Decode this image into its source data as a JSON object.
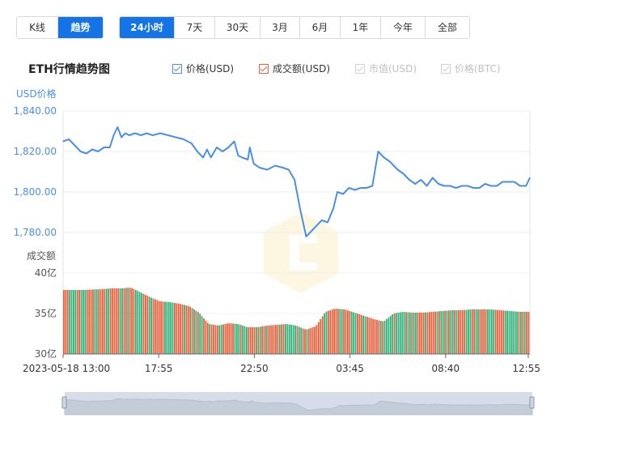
{
  "view_toggle": [
    {
      "label": "K线",
      "active": false
    },
    {
      "label": "趋势",
      "active": true
    }
  ],
  "ranges": [
    {
      "label": "24小时",
      "active": true
    },
    {
      "label": "7天",
      "active": false
    },
    {
      "label": "30天",
      "active": false
    },
    {
      "label": "3月",
      "active": false
    },
    {
      "label": "6月",
      "active": false
    },
    {
      "label": "1年",
      "active": false
    },
    {
      "label": "今年",
      "active": false
    },
    {
      "label": "全部",
      "active": false
    }
  ],
  "legend": [
    {
      "label": "价格(USD)",
      "checked": true,
      "enabled": true,
      "color": "#4a90e2"
    },
    {
      "label": "成交额(USD)",
      "checked": true,
      "enabled": true,
      "color": "#e8603c"
    },
    {
      "label": "市值(USD)",
      "checked": true,
      "enabled": false,
      "color": "#c8c8c8"
    },
    {
      "label": "价格(BTC)",
      "checked": true,
      "enabled": false,
      "color": "#c8c8c8"
    }
  ],
  "colors": {
    "price_line": "#4a90e2",
    "bar_up": "#e8603c",
    "bar_down": "#2db37a",
    "axis_text": "#4a90e2",
    "navigator": "#d6dde8"
  },
  "chart_data": {
    "type": "line",
    "title": "ETH行情趋势图",
    "price_axis_label": "USD价格",
    "volume_axis_label": "成交额",
    "price_ylim": [
      1780,
      1840
    ],
    "price_ticks": [
      "1,840.00",
      "1,820.00",
      "1,800.00",
      "1,780.00"
    ],
    "volume_ylim": [
      30,
      40
    ],
    "volume_ticks": [
      "40亿",
      "35亿",
      "30亿"
    ],
    "x_ticks": [
      "2023-05-18 13:00",
      "17:55",
      "22:50",
      "03:45",
      "08:40",
      "12:55"
    ],
    "x_tick_hours": [
      0,
      4.917,
      9.833,
      14.75,
      19.667,
      23.917
    ],
    "x_range_hours": [
      0,
      24
    ],
    "price_series": {
      "name": "价格(USD)",
      "x_hours": [
        0,
        0.3,
        0.6,
        0.9,
        1.2,
        1.5,
        1.8,
        2.1,
        2.4,
        2.6,
        2.8,
        3.0,
        3.2,
        3.4,
        3.7,
        4.0,
        4.3,
        4.6,
        5.0,
        5.4,
        5.8,
        6.2,
        6.6,
        6.9,
        7.2,
        7.4,
        7.6,
        7.9,
        8.2,
        8.5,
        8.8,
        9.0,
        9.2,
        9.5,
        9.6,
        9.8,
        10.1,
        10.5,
        10.9,
        11.3,
        11.6,
        11.9,
        12.2,
        12.5,
        12.8,
        13.0,
        13.3,
        13.6,
        13.9,
        14.1,
        14.4,
        14.7,
        15.0,
        15.3,
        15.6,
        15.9,
        16.2,
        16.5,
        16.8,
        17.0,
        17.2,
        17.5,
        17.8,
        18.1,
        18.4,
        18.7,
        19.0,
        19.3,
        19.6,
        19.9,
        20.2,
        20.5,
        20.8,
        21.1,
        21.4,
        21.7,
        22.0,
        22.3,
        22.6,
        22.9,
        23.2,
        23.5,
        23.8,
        24.0
      ],
      "values": [
        1825,
        1826,
        1823,
        1820,
        1819,
        1821,
        1820,
        1822,
        1822,
        1828,
        1832,
        1827,
        1829,
        1828,
        1829,
        1828,
        1829,
        1828,
        1829,
        1828,
        1827,
        1826,
        1824,
        1820,
        1817,
        1821,
        1817,
        1822,
        1820,
        1822,
        1825,
        1818,
        1817,
        1816,
        1822,
        1814,
        1812,
        1811,
        1813,
        1812,
        1811,
        1806,
        1791,
        1778,
        1781,
        1783,
        1786,
        1785,
        1792,
        1800,
        1799,
        1802,
        1801,
        1802,
        1802,
        1803,
        1820,
        1817,
        1815,
        1813,
        1811,
        1809,
        1806,
        1804,
        1806,
        1803,
        1807,
        1804,
        1803,
        1803,
        1802,
        1803,
        1803,
        1802,
        1802,
        1804,
        1803,
        1803,
        1805,
        1805,
        1805,
        1803,
        1803,
        1807
      ]
    },
    "volume_series": {
      "name": "成交额(USD)",
      "x_hours": [
        0,
        1,
        2,
        2.5,
        3,
        3.5,
        4,
        4.5,
        5,
        5.5,
        6,
        6.5,
        7,
        7.5,
        8,
        8.5,
        9,
        9.5,
        10,
        10.5,
        11,
        11.5,
        12,
        12.5,
        13,
        13.5,
        14,
        14.5,
        15,
        15.5,
        16,
        16.5,
        17,
        17.5,
        18,
        18.5,
        19,
        19.5,
        20,
        20.5,
        21,
        21.5,
        22,
        22.5,
        23,
        23.5,
        24
      ],
      "values": [
        37.9,
        37.9,
        38.0,
        38.1,
        38.1,
        38.2,
        37.6,
        37.0,
        36.5,
        36.4,
        36.2,
        35.9,
        35.1,
        33.7,
        33.5,
        33.8,
        33.7,
        33.3,
        33.3,
        33.5,
        33.6,
        33.7,
        33.5,
        33.0,
        33.4,
        35.2,
        35.6,
        35.5,
        35.1,
        34.7,
        34.3,
        34.0,
        35.0,
        35.2,
        35.1,
        35.1,
        35.2,
        35.3,
        35.4,
        35.4,
        35.5,
        35.5,
        35.5,
        35.4,
        35.3,
        35.2,
        35.2
      ]
    }
  }
}
